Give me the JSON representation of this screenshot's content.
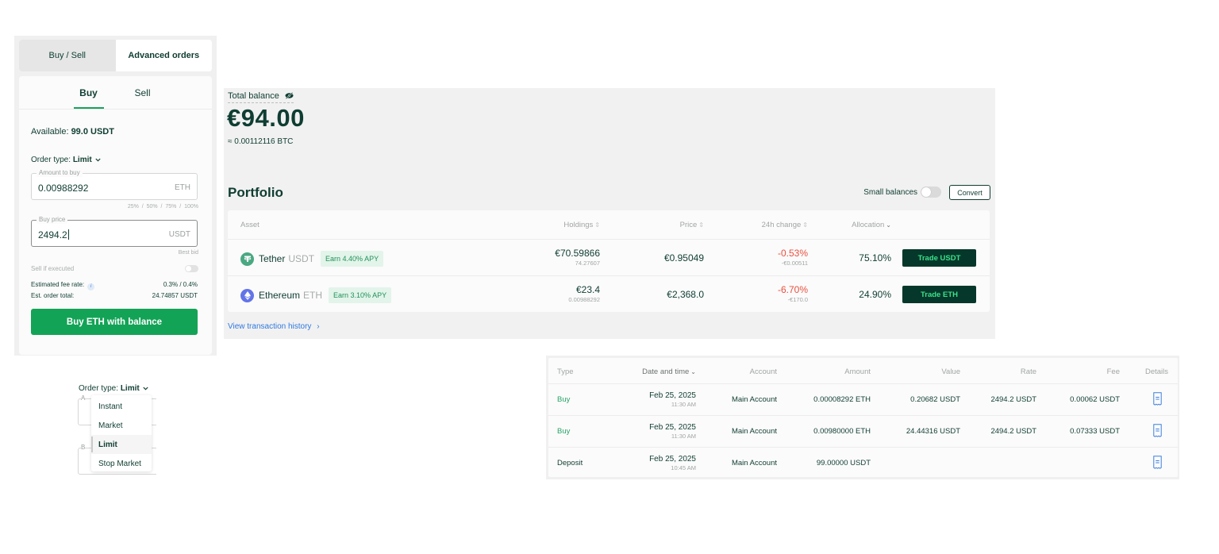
{
  "trade_panel": {
    "top_tabs": [
      {
        "label": "Buy / Sell",
        "active": false
      },
      {
        "label": "Advanced orders",
        "active": true
      }
    ],
    "side_tabs": [
      {
        "label": "Buy",
        "active": true
      },
      {
        "label": "Sell",
        "active": false
      }
    ],
    "available_label": "Available:",
    "available_value": "99.0 USDT",
    "order_type_label": "Order type:",
    "order_type_value": "Limit",
    "amount_field": {
      "legend": "Amount to buy",
      "value": "0.00988292",
      "unit": "ETH"
    },
    "percent_options": [
      "25%",
      "50%",
      "75%",
      "100%"
    ],
    "percent_separator": "/",
    "price_field": {
      "legend": "Buy price",
      "value": "2494.2",
      "unit": "USDT"
    },
    "best_bid_label": "Best bid",
    "sell_if_executed_label": "Sell if executed",
    "sell_if_executed_on": false,
    "fee_rate_label": "Estimated fee rate:",
    "fee_rate_value": "0.3% / 0.4%",
    "order_total_label": "Est. order total:",
    "order_total_value": "24.74857 USDT",
    "submit_label": "Buy ETH with balance"
  },
  "order_type_dropdown": {
    "label": "Order type:",
    "value": "Limit",
    "bg_legend_1": "A",
    "bg_legend_2": "B",
    "options": [
      {
        "label": "Instant",
        "selected": false
      },
      {
        "label": "Market",
        "selected": false
      },
      {
        "label": "Limit",
        "selected": true
      },
      {
        "label": "Stop Market",
        "selected": false
      }
    ]
  },
  "balance": {
    "label": "Total balance",
    "value": "€94.00",
    "btc_equiv": "≈ 0.00112116 BTC"
  },
  "portfolio": {
    "title": "Portfolio",
    "small_balances_label": "Small balances",
    "small_balances_on": false,
    "convert_label": "Convert",
    "columns": {
      "asset": "Asset",
      "holdings": "Holdings",
      "price": "Price",
      "change": "24h change",
      "allocation": "Allocation"
    },
    "rows": [
      {
        "icon": "tether-icon",
        "name": "Tether",
        "symbol": "USDT",
        "earn": "Earn 4.40% APY",
        "holdings_fiat": "€70.59866",
        "holdings_amount": "74.27607",
        "price": "€0.95049",
        "change_pct": "-0.53%",
        "change_abs": "-€0.00511",
        "allocation": "75.10%",
        "trade_label": "Trade USDT"
      },
      {
        "icon": "ethereum-icon",
        "name": "Ethereum",
        "symbol": "ETH",
        "earn": "Earn 3.10% APY",
        "holdings_fiat": "€23.4",
        "holdings_amount": "0.00988292",
        "price": "€2,368.0",
        "change_pct": "-6.70%",
        "change_abs": "-€170.0",
        "allocation": "24.90%",
        "trade_label": "Trade ETH"
      }
    ],
    "history_link": "View transaction history",
    "history_chevron": "›"
  },
  "transactions": {
    "columns": {
      "type": "Type",
      "date": "Date and time",
      "account": "Account",
      "amount": "Amount",
      "value": "Value",
      "rate": "Rate",
      "fee": "Fee",
      "details": "Details"
    },
    "rows": [
      {
        "type": "Buy",
        "date": "Feb 25, 2025",
        "time": "11:30 AM",
        "account": "Main Account",
        "amount": "0.00008292 ETH",
        "value": "0.20682 USDT",
        "rate": "2494.2 USDT",
        "fee": "0.00062 USDT"
      },
      {
        "type": "Buy",
        "date": "Feb 25, 2025",
        "time": "11:30 AM",
        "account": "Main Account",
        "amount": "0.00980000 ETH",
        "value": "24.44316 USDT",
        "rate": "2494.2 USDT",
        "fee": "0.07333 USDT"
      },
      {
        "type": "Deposit",
        "date": "Feb 25, 2025",
        "time": "10:45 AM",
        "account": "Main Account",
        "amount": "99.00000 USDT",
        "value": "",
        "rate": "",
        "fee": ""
      }
    ]
  },
  "colors": {
    "primary_green": "#13a356",
    "dark_green": "#05382a",
    "text_dark": "#0f3d32",
    "negative": "#e9503e",
    "link_blue": "#2f7ae0"
  }
}
